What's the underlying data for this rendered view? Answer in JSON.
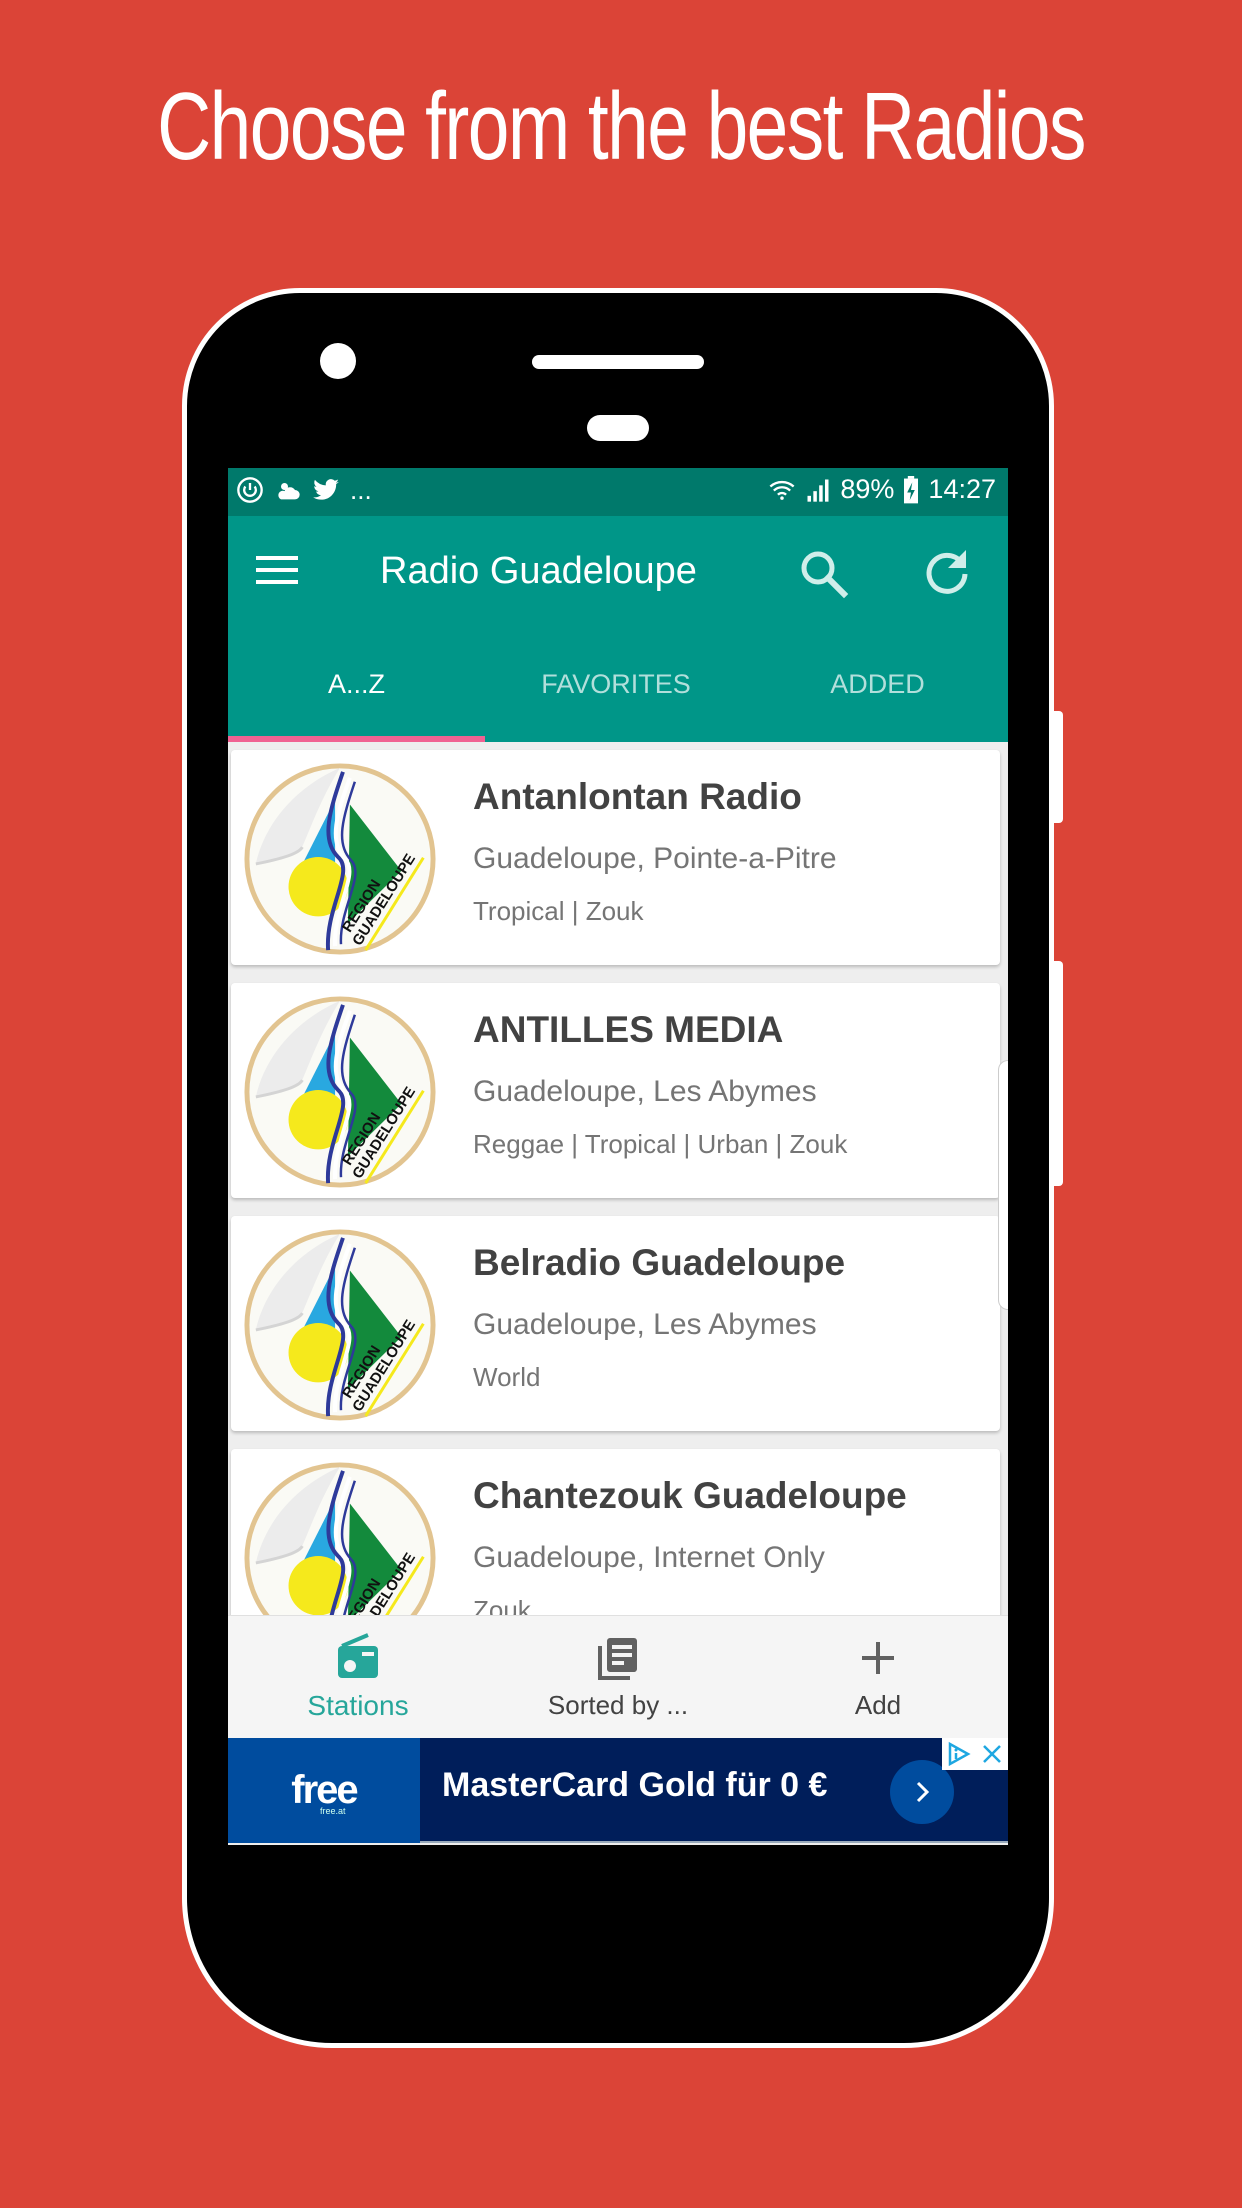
{
  "promo": {
    "headline": "Choose from the best Radios",
    "background_color": "#DB4437"
  },
  "status_bar": {
    "left_icons": [
      "sync-icon",
      "weather-icon",
      "twitter-icon"
    ],
    "overflow": "...",
    "battery": "89%",
    "time": "14:27",
    "right_icons": [
      "wifi-icon",
      "signal-icon",
      "battery-charging-icon"
    ]
  },
  "app_bar": {
    "title": "Radio Guadeloupe",
    "actions": [
      "search-icon",
      "refresh-icon"
    ],
    "color": "#009688"
  },
  "tabs": [
    {
      "label": "A...Z",
      "active": true
    },
    {
      "label": "FAVORITES",
      "active": false
    },
    {
      "label": "ADDED",
      "active": false
    }
  ],
  "stations": [
    {
      "name": "Antanlontan Radio",
      "location": "Guadeloupe, Pointe-a-Pitre",
      "genres": "Tropical | Zouk"
    },
    {
      "name": "ANTILLES MEDIA",
      "location": "Guadeloupe, Les Abymes",
      "genres": "Reggae | Tropical | Urban | Zouk"
    },
    {
      "name": "Belradio Guadeloupe",
      "location": "Guadeloupe, Les Abymes",
      "genres": "World"
    },
    {
      "name": "Chantezouk Guadeloupe",
      "location": "Guadeloupe, Internet Only",
      "genres": "Zouk"
    }
  ],
  "logo": {
    "text_line1": "REGION",
    "text_line2": "GUADELOUPE"
  },
  "bottom_nav": [
    {
      "label": "Stations",
      "icon": "radio-icon",
      "active": true
    },
    {
      "label": "Sorted by ...",
      "icon": "library-books-icon",
      "active": false
    },
    {
      "label": "Add",
      "icon": "plus-icon",
      "active": false
    }
  ],
  "ad": {
    "brand": "free",
    "brand_sub": "free.at",
    "text": "MasterCard Gold für 0 €"
  }
}
